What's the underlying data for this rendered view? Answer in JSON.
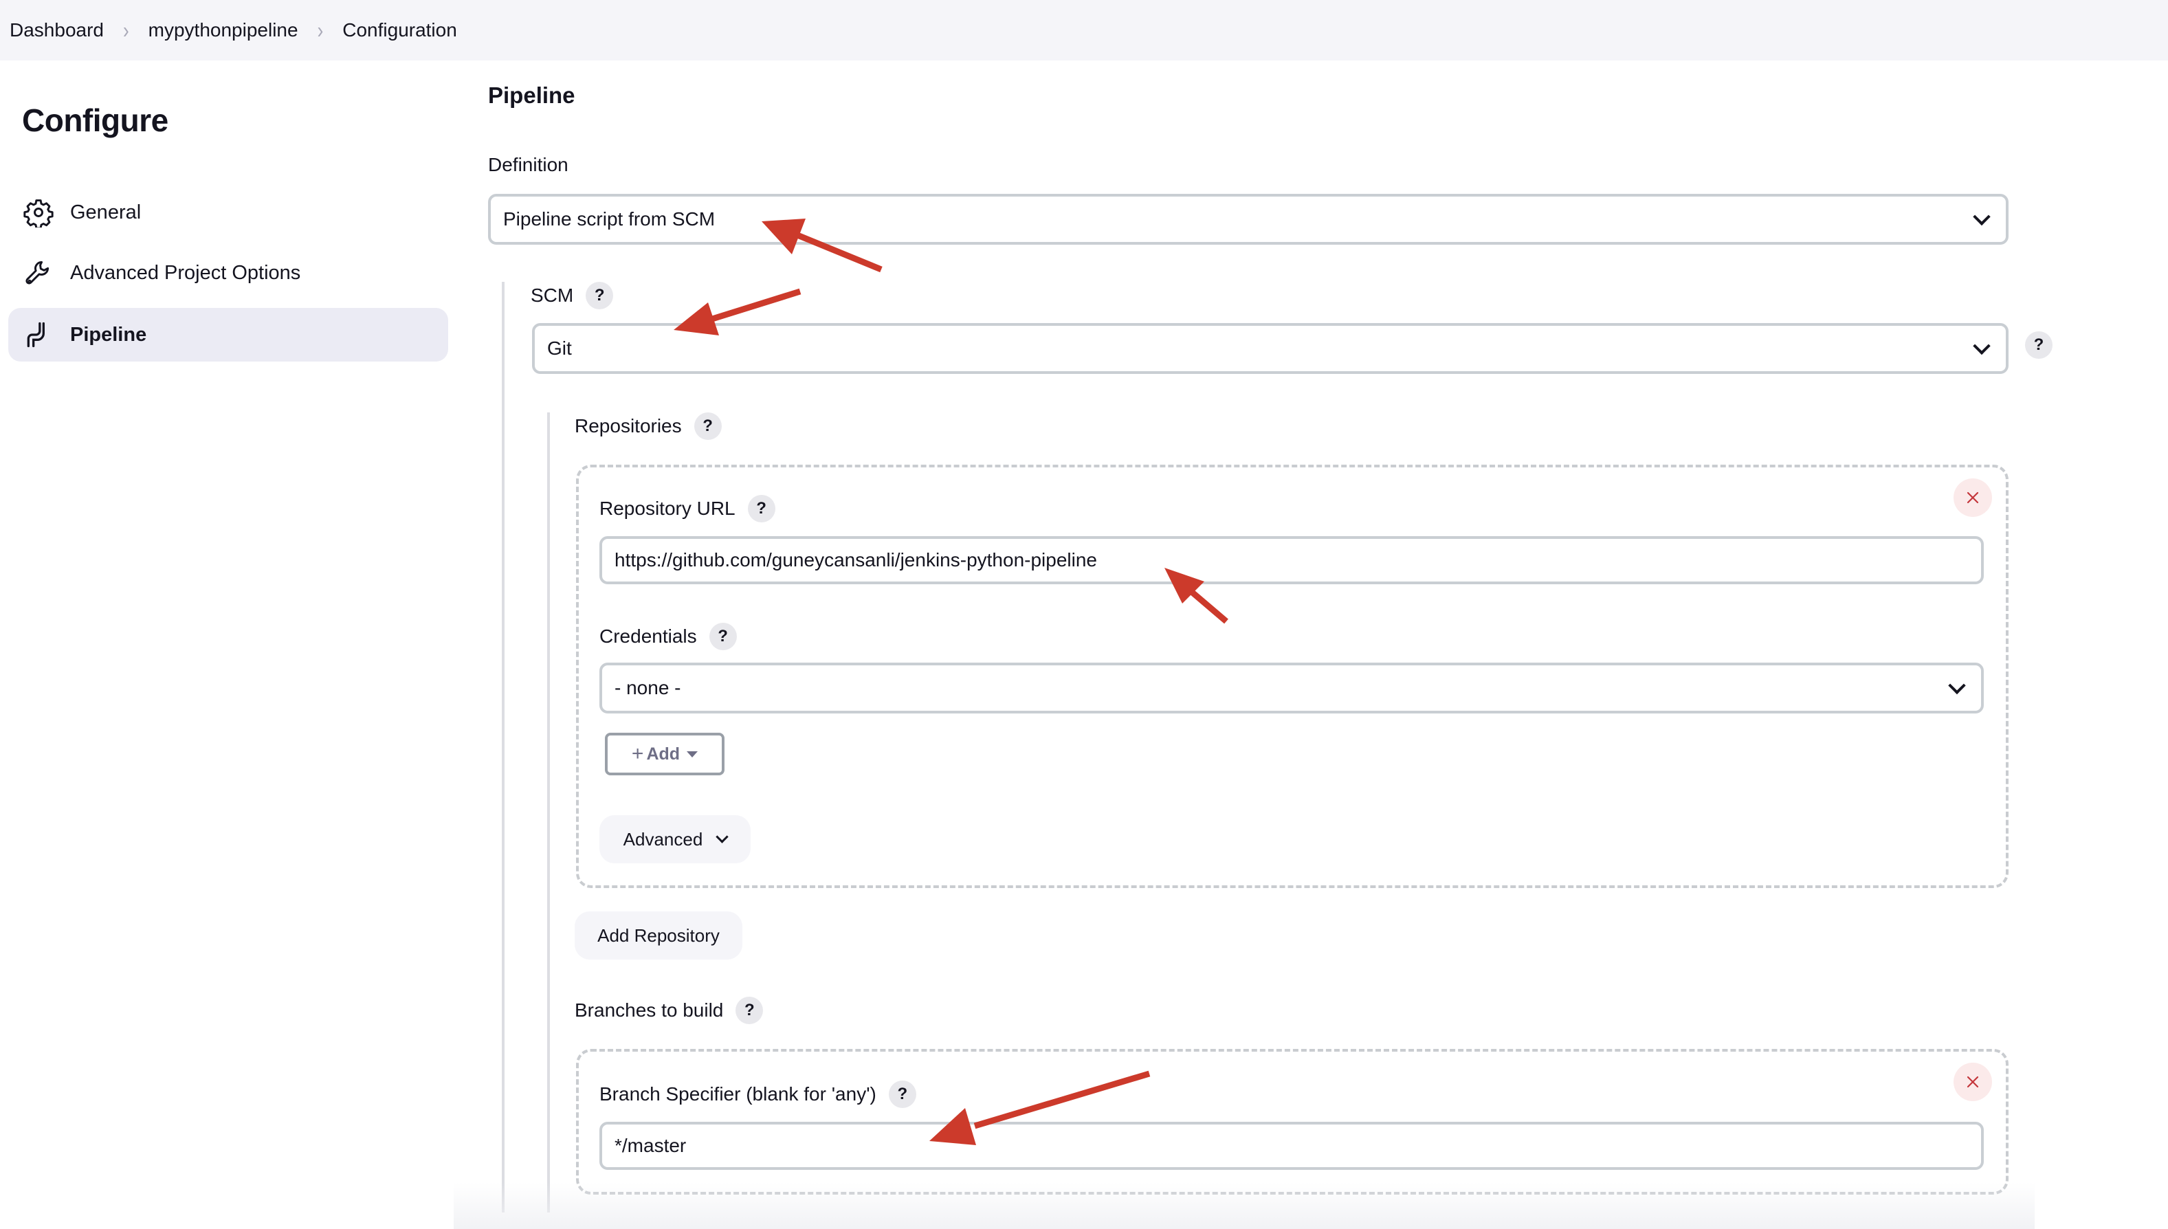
{
  "breadcrumb": {
    "items": [
      "Dashboard",
      "mypythonpipeline",
      "Configuration"
    ],
    "separator": "›"
  },
  "sidebar": {
    "title": "Configure",
    "items": [
      {
        "label": "General",
        "icon": "gear-icon",
        "active": false
      },
      {
        "label": "Advanced Project Options",
        "icon": "wrench-icon",
        "active": false
      },
      {
        "label": "Pipeline",
        "icon": "pipeline-icon",
        "active": true
      }
    ]
  },
  "main": {
    "section_title": "Pipeline",
    "definition": {
      "label": "Definition",
      "selected": "Pipeline script from SCM"
    },
    "scm": {
      "label": "SCM",
      "help": "?",
      "selected": "Git"
    },
    "repositories": {
      "label": "Repositories",
      "help": "?",
      "repository_url": {
        "label": "Repository URL",
        "help": "?",
        "value": "https://github.com/guneycansanli/jenkins-python-pipeline"
      },
      "credentials": {
        "label": "Credentials",
        "help": "?",
        "selected": "- none -"
      },
      "add_button": "Add",
      "add_prefix": "+",
      "advanced_button": "Advanced",
      "add_repository_button": "Add Repository"
    },
    "branches": {
      "label": "Branches to build",
      "help": "?",
      "specifier": {
        "label": "Branch Specifier (blank for 'any')",
        "help": "?",
        "value": "*/master"
      }
    }
  },
  "colors": {
    "breadcrumb_bg": "#f5f5f9",
    "active_item_bg": "#ebebf4",
    "input_border": "#c9ced3",
    "remove_bg": "#fbeaea",
    "remove_x": "#c4363b",
    "annotation_arrow": "#cc3a2b"
  }
}
